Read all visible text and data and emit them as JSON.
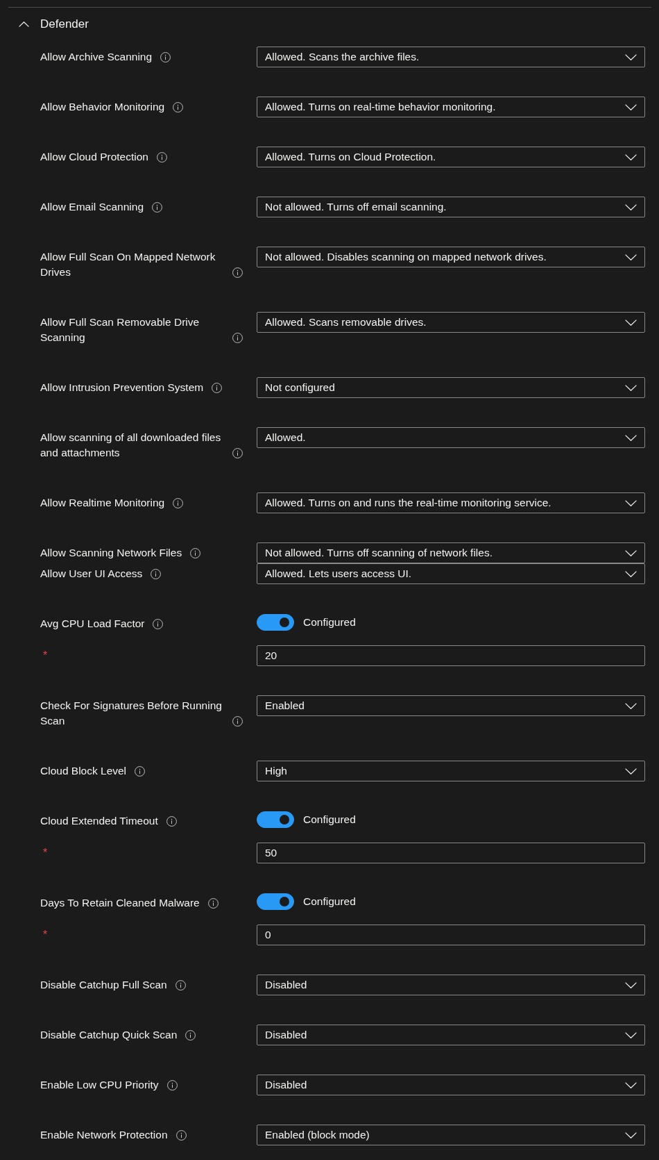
{
  "section": {
    "title": "Defender",
    "expanded": true
  },
  "settings": [
    {
      "kind": "dropdown",
      "label": "Allow Archive Scanning",
      "value": "Allowed. Scans the archive files."
    },
    {
      "kind": "dropdown",
      "label": "Allow Behavior Monitoring",
      "value": "Allowed. Turns on real-time behavior monitoring."
    },
    {
      "kind": "dropdown",
      "label": "Allow Cloud Protection",
      "value": "Allowed. Turns on Cloud Protection."
    },
    {
      "kind": "dropdown",
      "label": "Allow Email Scanning",
      "value": "Not allowed. Turns off email scanning."
    },
    {
      "kind": "dropdown",
      "label": "Allow Full Scan On Mapped Network Drives",
      "value": "Not allowed. Disables scanning on mapped network drives."
    },
    {
      "kind": "dropdown",
      "label": "Allow Full Scan Removable Drive Scanning",
      "value": "Allowed. Scans removable drives."
    },
    {
      "kind": "dropdown",
      "label": "Allow Intrusion Prevention System",
      "value": "Not configured"
    },
    {
      "kind": "dropdown",
      "label": "Allow scanning of all downloaded files and attachments",
      "value": "Allowed."
    },
    {
      "kind": "dropdown",
      "label": "Allow Realtime Monitoring",
      "value": "Allowed. Turns on and runs the real-time monitoring service."
    },
    {
      "kind": "dropdown",
      "label": "Allow Scanning Network Files",
      "value": "Not allowed. Turns off scanning of network files."
    },
    {
      "kind": "dropdown",
      "label": "Allow User UI Access",
      "value": "Allowed. Lets users access UI."
    },
    {
      "kind": "toggle",
      "label": "Avg CPU Load Factor",
      "switch": {
        "on": true,
        "text": "Configured"
      },
      "input": {
        "required_mark": "*",
        "value": "20"
      }
    },
    {
      "kind": "dropdown",
      "label": "Check For Signatures Before Running Scan",
      "value": "Enabled"
    },
    {
      "kind": "dropdown",
      "label": "Cloud Block Level",
      "value": "High"
    },
    {
      "kind": "toggle",
      "label": "Cloud Extended Timeout",
      "switch": {
        "on": true,
        "text": "Configured"
      },
      "input": {
        "required_mark": "*",
        "value": "50"
      }
    },
    {
      "kind": "toggle",
      "label": "Days To Retain Cleaned Malware",
      "switch": {
        "on": true,
        "text": "Configured"
      },
      "input": {
        "required_mark": "*",
        "value": "0"
      }
    },
    {
      "kind": "dropdown",
      "label": "Disable Catchup Full Scan",
      "value": "Disabled"
    },
    {
      "kind": "dropdown",
      "label": "Disable Catchup Quick Scan",
      "value": "Disabled"
    },
    {
      "kind": "dropdown",
      "label": "Enable Low CPU Priority",
      "value": "Disabled"
    },
    {
      "kind": "dropdown",
      "label": "Enable Network Protection",
      "value": "Enabled (block mode)"
    }
  ]
}
